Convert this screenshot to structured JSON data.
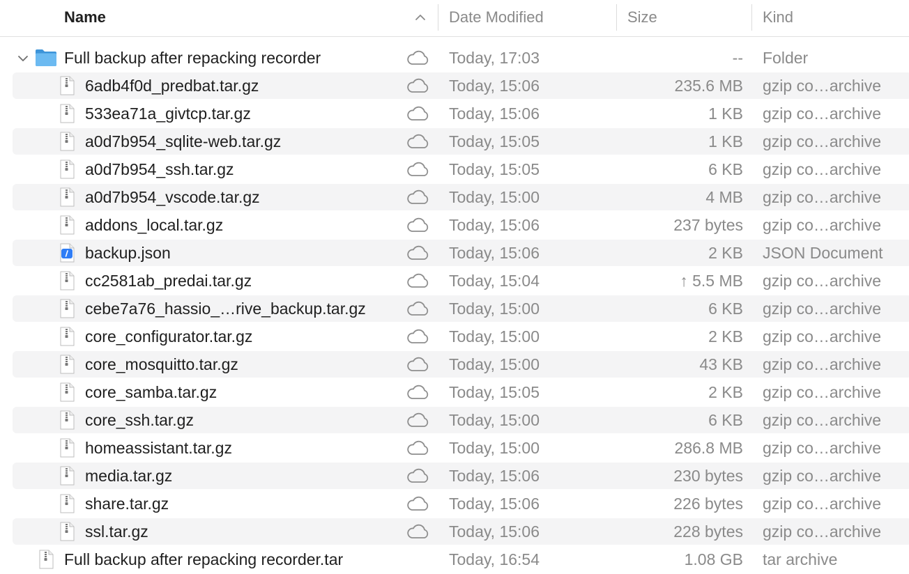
{
  "header": {
    "name": "Name",
    "date": "Date Modified",
    "size": "Size",
    "kind": "Kind"
  },
  "rows": [
    {
      "name": "Full backup after repacking recorder",
      "date": "Today, 17:03",
      "size": "--",
      "kind": "Folder"
    },
    {
      "name": "6adb4f0d_predbat.tar.gz",
      "date": "Today, 15:06",
      "size": "235.6 MB",
      "kind": "gzip co…archive"
    },
    {
      "name": "533ea71a_givtcp.tar.gz",
      "date": "Today, 15:06",
      "size": "1 KB",
      "kind": "gzip co…archive"
    },
    {
      "name": "a0d7b954_sqlite-web.tar.gz",
      "date": "Today, 15:05",
      "size": "1 KB",
      "kind": "gzip co…archive"
    },
    {
      "name": "a0d7b954_ssh.tar.gz",
      "date": "Today, 15:05",
      "size": "6 KB",
      "kind": "gzip co…archive"
    },
    {
      "name": "a0d7b954_vscode.tar.gz",
      "date": "Today, 15:00",
      "size": "4 MB",
      "kind": "gzip co…archive"
    },
    {
      "name": "addons_local.tar.gz",
      "date": "Today, 15:06",
      "size": "237 bytes",
      "kind": "gzip co…archive"
    },
    {
      "name": "backup.json",
      "date": "Today, 15:06",
      "size": "2 KB",
      "kind": "JSON Document"
    },
    {
      "name": "cc2581ab_predai.tar.gz",
      "date": "Today, 15:04",
      "size": "↑ 5.5 MB",
      "kind": "gzip co…archive"
    },
    {
      "name": "cebe7a76_hassio_…rive_backup.tar.gz",
      "date": "Today, 15:00",
      "size": "6 KB",
      "kind": "gzip co…archive"
    },
    {
      "name": "core_configurator.tar.gz",
      "date": "Today, 15:00",
      "size": "2 KB",
      "kind": "gzip co…archive"
    },
    {
      "name": "core_mosquitto.tar.gz",
      "date": "Today, 15:00",
      "size": "43 KB",
      "kind": "gzip co…archive"
    },
    {
      "name": "core_samba.tar.gz",
      "date": "Today, 15:05",
      "size": "2 KB",
      "kind": "gzip co…archive"
    },
    {
      "name": "core_ssh.tar.gz",
      "date": "Today, 15:00",
      "size": "6 KB",
      "kind": "gzip co…archive"
    },
    {
      "name": "homeassistant.tar.gz",
      "date": "Today, 15:00",
      "size": "286.8 MB",
      "kind": "gzip co…archive"
    },
    {
      "name": "media.tar.gz",
      "date": "Today, 15:06",
      "size": "230 bytes",
      "kind": "gzip co…archive"
    },
    {
      "name": "share.tar.gz",
      "date": "Today, 15:06",
      "size": "226 bytes",
      "kind": "gzip co…archive"
    },
    {
      "name": "ssl.tar.gz",
      "date": "Today, 15:06",
      "size": "228 bytes",
      "kind": "gzip co…archive"
    },
    {
      "name": "Full backup after repacking recorder.tar",
      "date": "Today, 16:54",
      "size": "1.08 GB",
      "kind": "tar archive"
    }
  ],
  "icons": {
    "folder": "folder-icon",
    "archive": "archive-file-icon",
    "json": "json-document-icon",
    "cloud": "icloud-status-icon",
    "sort": "sort-ascending-icon",
    "disclosure": "disclosure-triangle-icon"
  },
  "colors": {
    "folder_blue": "#5bb0ee",
    "stripe": "#f4f4f5",
    "secondary_text": "#8a8a8a"
  }
}
